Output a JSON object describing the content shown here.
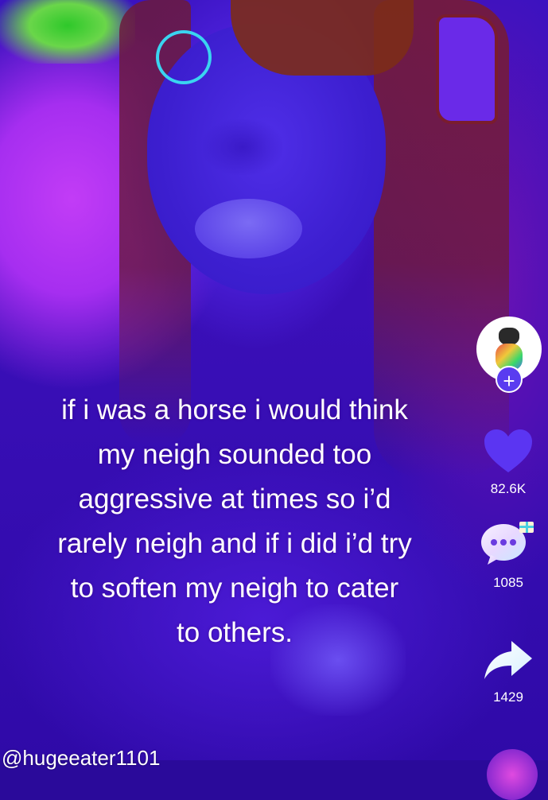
{
  "video": {
    "caption_lines": [
      "if i was a horse i would think",
      "my neigh sounded too",
      "aggressive at times so i’d",
      "rarely neigh and if i did i’d try",
      "to soften my neigh to cater",
      "to others."
    ]
  },
  "actions": {
    "like_count": "82.6K",
    "comment_count": "1085",
    "share_count": "1429",
    "follow_symbol": "+"
  },
  "author": {
    "handle": "@hugeeater1101"
  },
  "colors": {
    "accent": "#5a3cf0",
    "heart": "#5b35f2",
    "text": "#ffffff"
  },
  "icons": [
    "heart-icon",
    "comment-icon",
    "gift-icon",
    "share-icon",
    "plus-icon"
  ]
}
